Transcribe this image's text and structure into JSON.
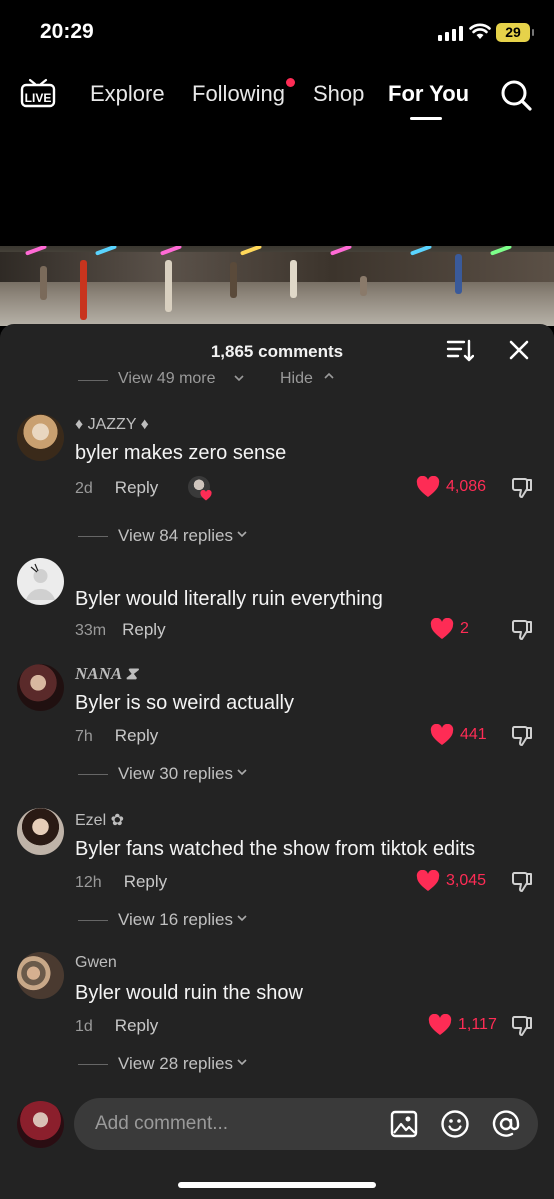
{
  "status_bar": {
    "time": "20:29",
    "battery": "29"
  },
  "top_nav": {
    "live_label": "LIVE",
    "tabs": [
      {
        "label": "Explore"
      },
      {
        "label": "Following"
      },
      {
        "label": "Shop"
      },
      {
        "label": "For You"
      }
    ],
    "active_tab": "For You"
  },
  "comments_sheet": {
    "title": "1,865 comments",
    "view_more": "View 49 more",
    "hide": "Hide",
    "comments": [
      {
        "username": "♦ JAZZY ♦",
        "text": "byler makes zero sense",
        "age": "2d",
        "reply_label": "Reply",
        "likes": "4,086",
        "view_replies": "View 84 replies"
      },
      {
        "username": "",
        "text": "Byler would literally ruin everything",
        "age": "33m",
        "reply_label": "Reply",
        "likes": "2",
        "view_replies": ""
      },
      {
        "username": "NANA ⧗",
        "text": "Byler is so weird actually",
        "age": "7h",
        "reply_label": "Reply",
        "likes": "441",
        "view_replies": "View 30 replies"
      },
      {
        "username": "Ezel ✿",
        "text": "Byler fans watched the show from tiktok edits",
        "age": "12h",
        "reply_label": "Reply",
        "likes": "3,045",
        "view_replies": "View 16 replies"
      },
      {
        "username": "Gwen",
        "text": "Byler would ruin the show",
        "age": "1d",
        "reply_label": "Reply",
        "likes": "1,117",
        "view_replies": "View 28 replies"
      }
    ]
  },
  "input_bar": {
    "placeholder": "Add comment..."
  },
  "colors": {
    "accent_like": "#fe2c55",
    "sheet_bg": "#232323",
    "input_bg": "#3a3a3a",
    "battery": "#e6d24a"
  }
}
